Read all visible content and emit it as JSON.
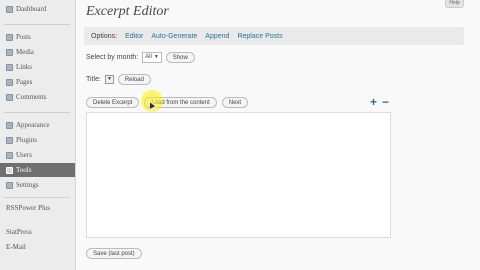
{
  "sidebar": {
    "items": [
      {
        "label": "Dashboard",
        "icon": "dashboard-icon"
      },
      {
        "label": "Posts",
        "icon": "pin-icon"
      },
      {
        "label": "Media",
        "icon": "media-icon"
      },
      {
        "label": "Links",
        "icon": "link-icon"
      },
      {
        "label": "Pages",
        "icon": "page-icon"
      },
      {
        "label": "Comments",
        "icon": "comment-icon"
      },
      {
        "label": "Appearance",
        "icon": "appearance-icon"
      },
      {
        "label": "Plugins",
        "icon": "plugin-icon"
      },
      {
        "label": "Users",
        "icon": "users-icon"
      },
      {
        "label": "Tools",
        "icon": "tools-icon",
        "active": true
      },
      {
        "label": "Settings",
        "icon": "settings-icon"
      }
    ],
    "plugins": [
      {
        "label": "RSSPower Plus"
      },
      {
        "label": "StatPress"
      },
      {
        "label": "E-Mail"
      }
    ]
  },
  "header": {
    "title": "Excerpt Editor",
    "help_label": "Help"
  },
  "options": {
    "label": "Options:",
    "links": [
      "Editor",
      "Auto-Generate",
      "Append",
      "Replace Posts"
    ]
  },
  "filter": {
    "label": "Select by month:",
    "selected": "All",
    "show_button": "Show"
  },
  "title_row": {
    "label": "Title:",
    "reload_button": "Reload"
  },
  "actions": {
    "delete_button": "Delete Excerpt",
    "load_button": "Load from the content",
    "next_button": "Next",
    "plus": "+",
    "minus": "−"
  },
  "footer": {
    "save_button": "Save (last post)"
  },
  "colors": {
    "link": "#21759b",
    "active_nav": "#6f6f6f",
    "cursor_highlight": "#fff000"
  }
}
